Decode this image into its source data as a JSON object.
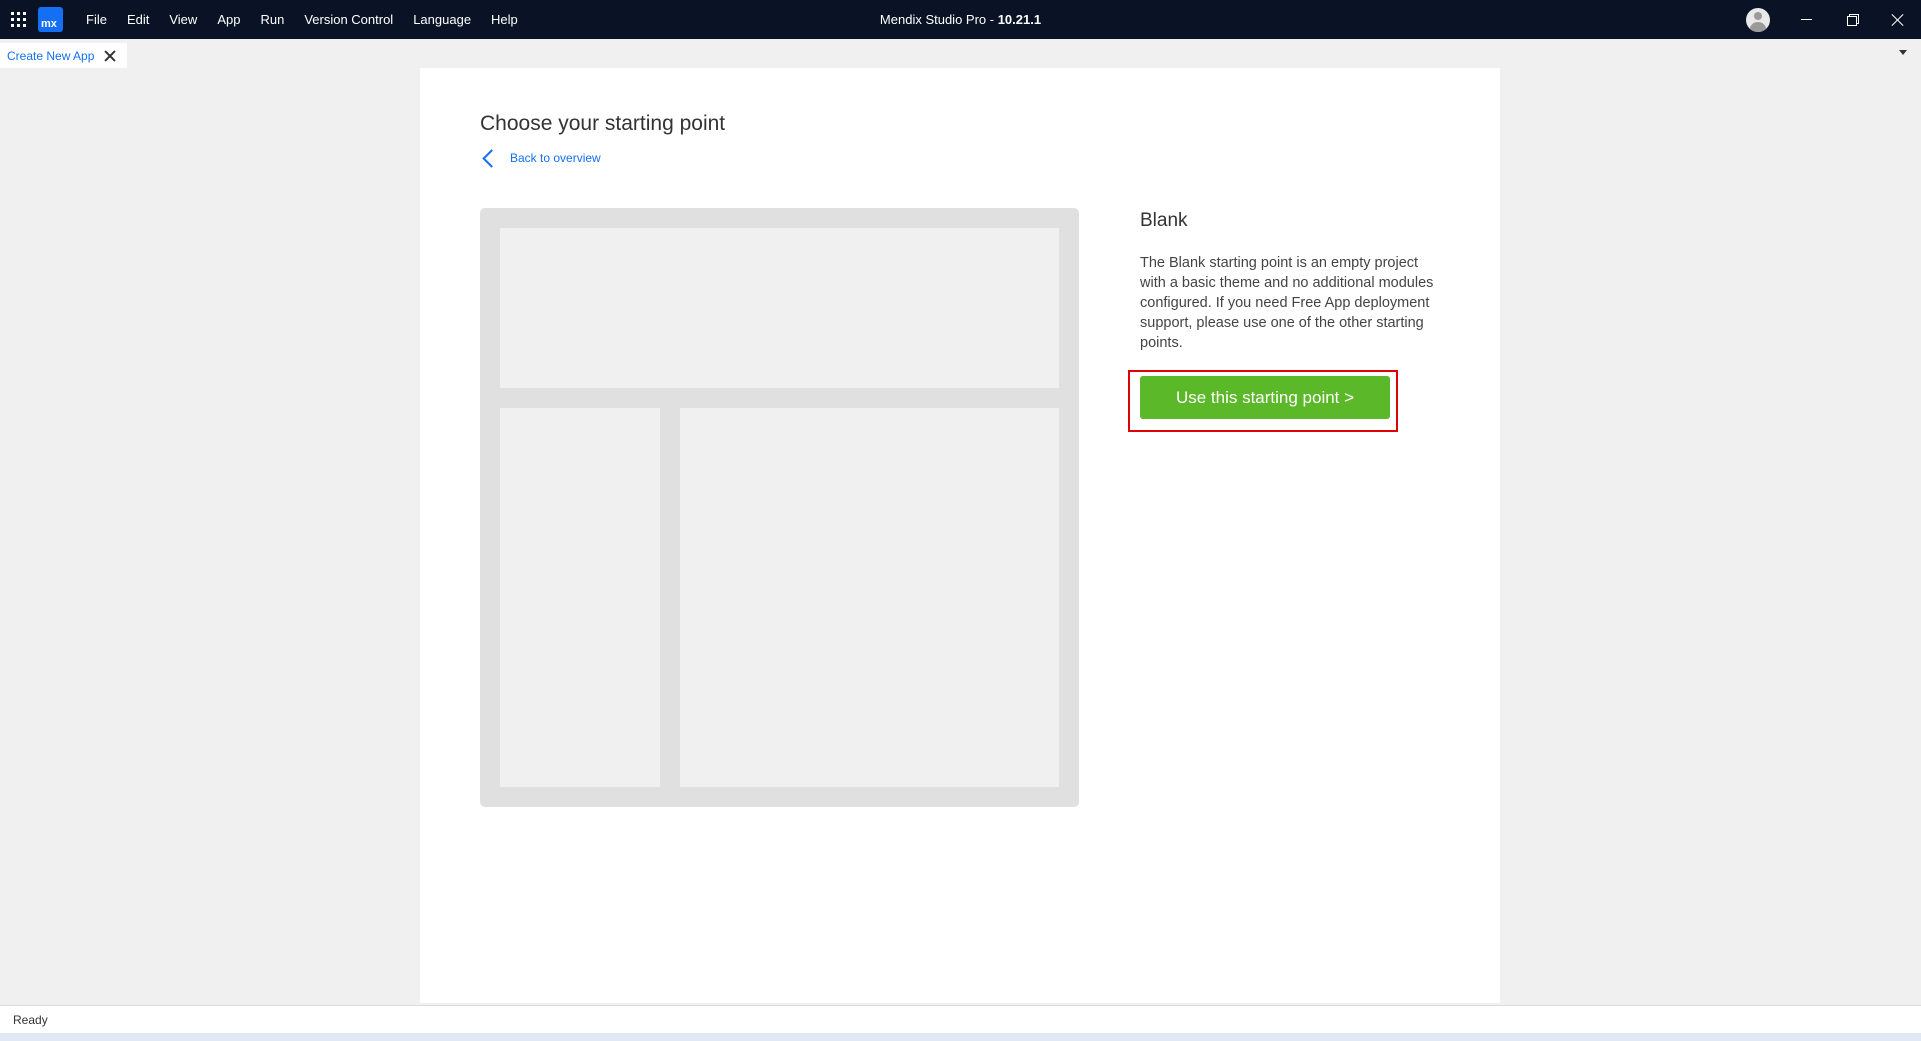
{
  "titlebar": {
    "app_logo": "mx",
    "app_name": "Mendix Studio Pro  -  ",
    "version": "10.21.1",
    "menu": [
      {
        "label": "File"
      },
      {
        "label": "Edit"
      },
      {
        "label": "View"
      },
      {
        "label": "App"
      },
      {
        "label": "Run"
      },
      {
        "label": "Version Control"
      },
      {
        "label": "Language"
      },
      {
        "label": "Help"
      }
    ],
    "icons": [
      "apps-grid-icon",
      "user-avatar-icon",
      "minimize-icon",
      "restore-icon",
      "close-icon"
    ]
  },
  "tabs": [
    {
      "label": "Create New App",
      "active": true
    }
  ],
  "page": {
    "title": "Choose your starting point",
    "back_link": "Back to overview"
  },
  "template": {
    "name": "Blank",
    "description": "The Blank starting point is an empty project with a basic theme and no additional modules configured. If you need Free App deployment support, please use one of the other starting points.",
    "cta_label": "Use this starting point >"
  },
  "status": {
    "text": "Ready"
  },
  "colors": {
    "titlebar_bg": "#0a1325",
    "accent": "#146ff4",
    "cta_green": "#5bb829",
    "highlight_red": "#e00000"
  }
}
